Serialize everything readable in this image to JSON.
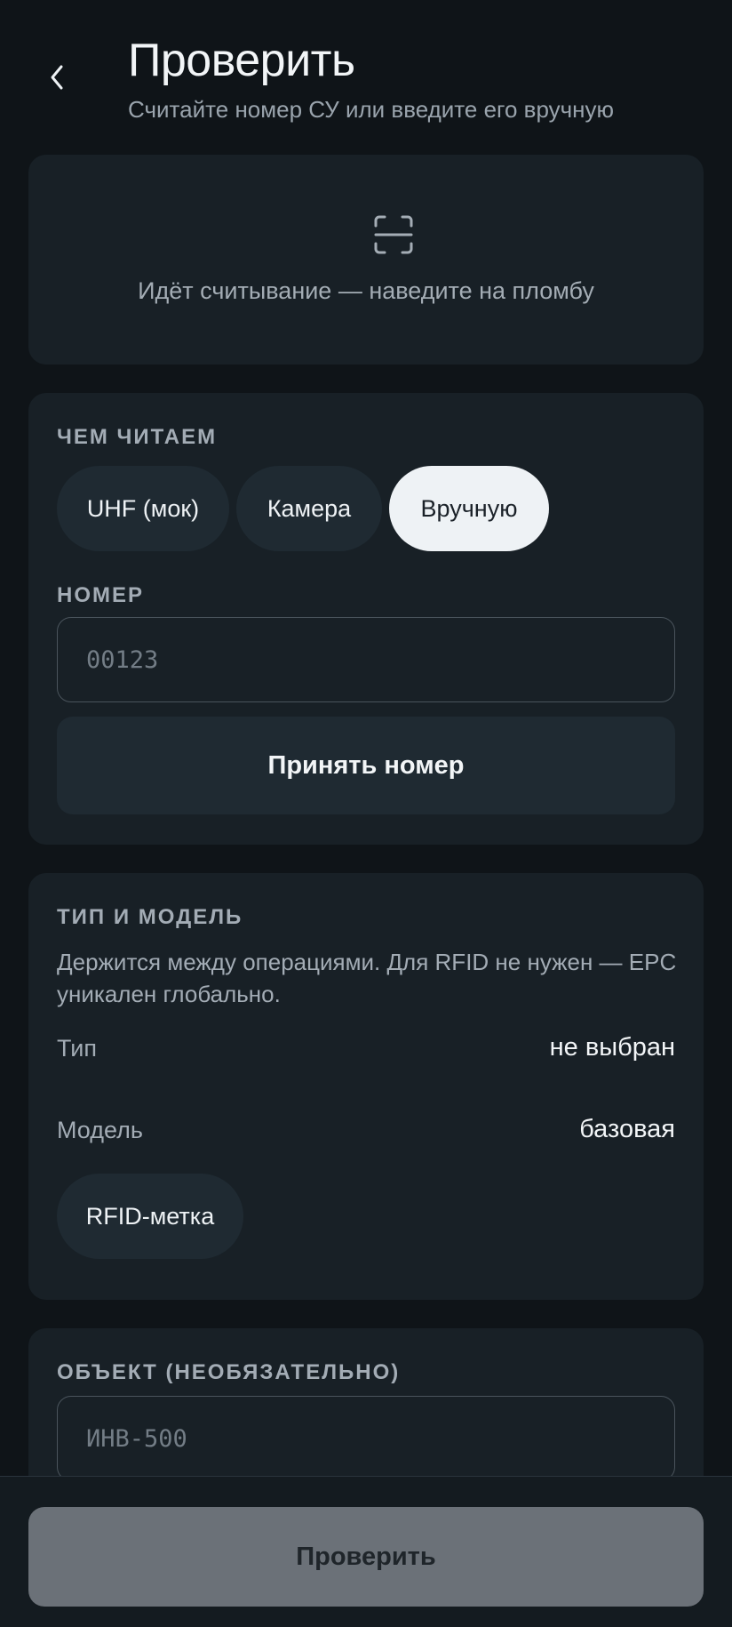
{
  "header": {
    "title": "Проверить",
    "subtitle": "Считайте номер СУ или введите его вручную"
  },
  "scan": {
    "status_text": "Идёт считывание — наведите на пломбу",
    "icon": "scan-frame-icon"
  },
  "reader": {
    "section_label": "ЧЕМ ЧИТАЕМ",
    "options": [
      {
        "label": "UHF (мок)",
        "active": false
      },
      {
        "label": "Камера",
        "active": false
      },
      {
        "label": "Вручную",
        "active": true
      }
    ],
    "number_label": "НОМЕР",
    "number_placeholder": "00123",
    "accept_label": "Принять номер"
  },
  "type_model": {
    "section_label": "ТИП И МОДЕЛЬ",
    "description": "Держится между операциями. Для RFID не нужен — EPC уникален глобально.",
    "type_label": "Тип",
    "type_value": "не выбран",
    "model_label": "Модель",
    "model_value": "базовая",
    "tag_chip": "RFID-метка"
  },
  "object": {
    "section_label": "ОБЪЕКТ (НЕОБЯЗАТЕЛЬНО)",
    "placeholder": "ИНВ-500"
  },
  "footer": {
    "check_label": "Проверить"
  },
  "colors": {
    "background": "#0f1418",
    "card": "#182026",
    "chip": "#1f2a32",
    "active_chip": "#eef2f5",
    "disabled_button": "#6b7178"
  }
}
